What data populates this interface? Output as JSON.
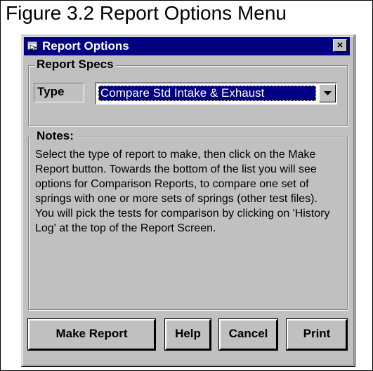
{
  "figure": {
    "caption": "Figure 3.2  Report Options Menu"
  },
  "window": {
    "title": "Report Options",
    "close_label": "×"
  },
  "report_specs": {
    "legend": "Report Specs",
    "type_label": "Type",
    "type_value": "Compare Std Intake & Exhaust"
  },
  "notes": {
    "legend": "Notes:",
    "text": "Select the type of report to make, then click on the Make Report button.  Towards the bottom of the list you will see options for Comparison Reports, to compare one set of springs with one or more sets of springs (other test files).  You will pick the tests for comparison by clicking on 'History Log' at the top of the Report Screen."
  },
  "buttons": {
    "make_report": "Make Report",
    "help": "Help",
    "cancel": "Cancel",
    "print": "Print"
  },
  "colors": {
    "titlebar": "#000080",
    "face": "#c0c0c0",
    "selection": "#000080"
  },
  "icons": {
    "title": "window-app-icon",
    "close": "close-icon",
    "dropdown": "chevron-down-icon"
  }
}
